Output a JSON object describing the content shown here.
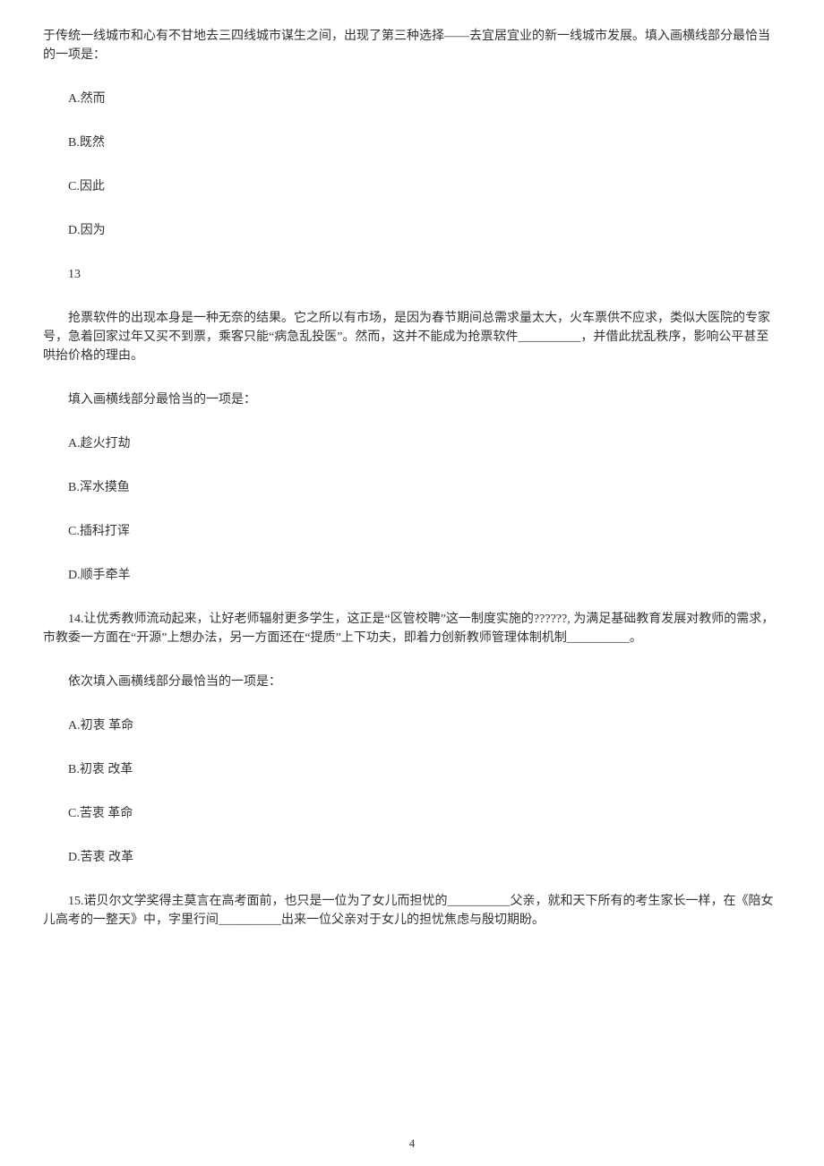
{
  "q12": {
    "stem_cont": "于传统一线城市和心有不甘地去三四线城市谋生之间，出现了第三种选择——去宜居宜业的新一线城市发展。填入画横线部分最恰当的一项是：",
    "options": {
      "a": "A.然而",
      "b": "B.既然",
      "c": "C.因此",
      "d": "D.因为"
    }
  },
  "q13": {
    "number": "13",
    "stem": "抢票软件的出现本身是一种无奈的结果。它之所以有市场，是因为春节期间总需求量太大，火车票供不应求，类似大医院的专家号，急着回家过年又买不到票，乘客只能“病急乱投医”。然而，这并不能成为抢票软件__________，并借此扰乱秩序，影响公平甚至哄抬价格的理由。",
    "instruction": "填入画横线部分最恰当的一项是：",
    "options": {
      "a": "A.趁火打劫",
      "b": "B.浑水摸鱼",
      "c": "C.插科打诨",
      "d": "D.顺手牵羊"
    }
  },
  "q14": {
    "stem": "14.让优秀教师流动起来，让好老师辐射更多学生，这正是“区管校聘”这一制度实施的??????, 为满足基础教育发展对教师的需求，市教委一方面在“开源”上想办法，另一方面还在“提质”上下功夫，即着力创新教师管理体制机制__________。",
    "instruction": "依次填入画横线部分最恰当的一项是：",
    "options": {
      "a": "A.初衷 革命",
      "b": "B.初衷 改革",
      "c": "C.苦衷 革命",
      "d": "D.苦衷 改革"
    }
  },
  "q15": {
    "stem": "15.诺贝尔文学奖得主莫言在高考面前，也只是一位为了女儿而担忧的__________父亲，就和天下所有的考生家长一样，在《陪女儿高考的一整天》中，字里行间__________出来一位父亲对于女儿的担忧焦虑与殷切期盼。"
  },
  "footer": {
    "page_number": "4"
  }
}
